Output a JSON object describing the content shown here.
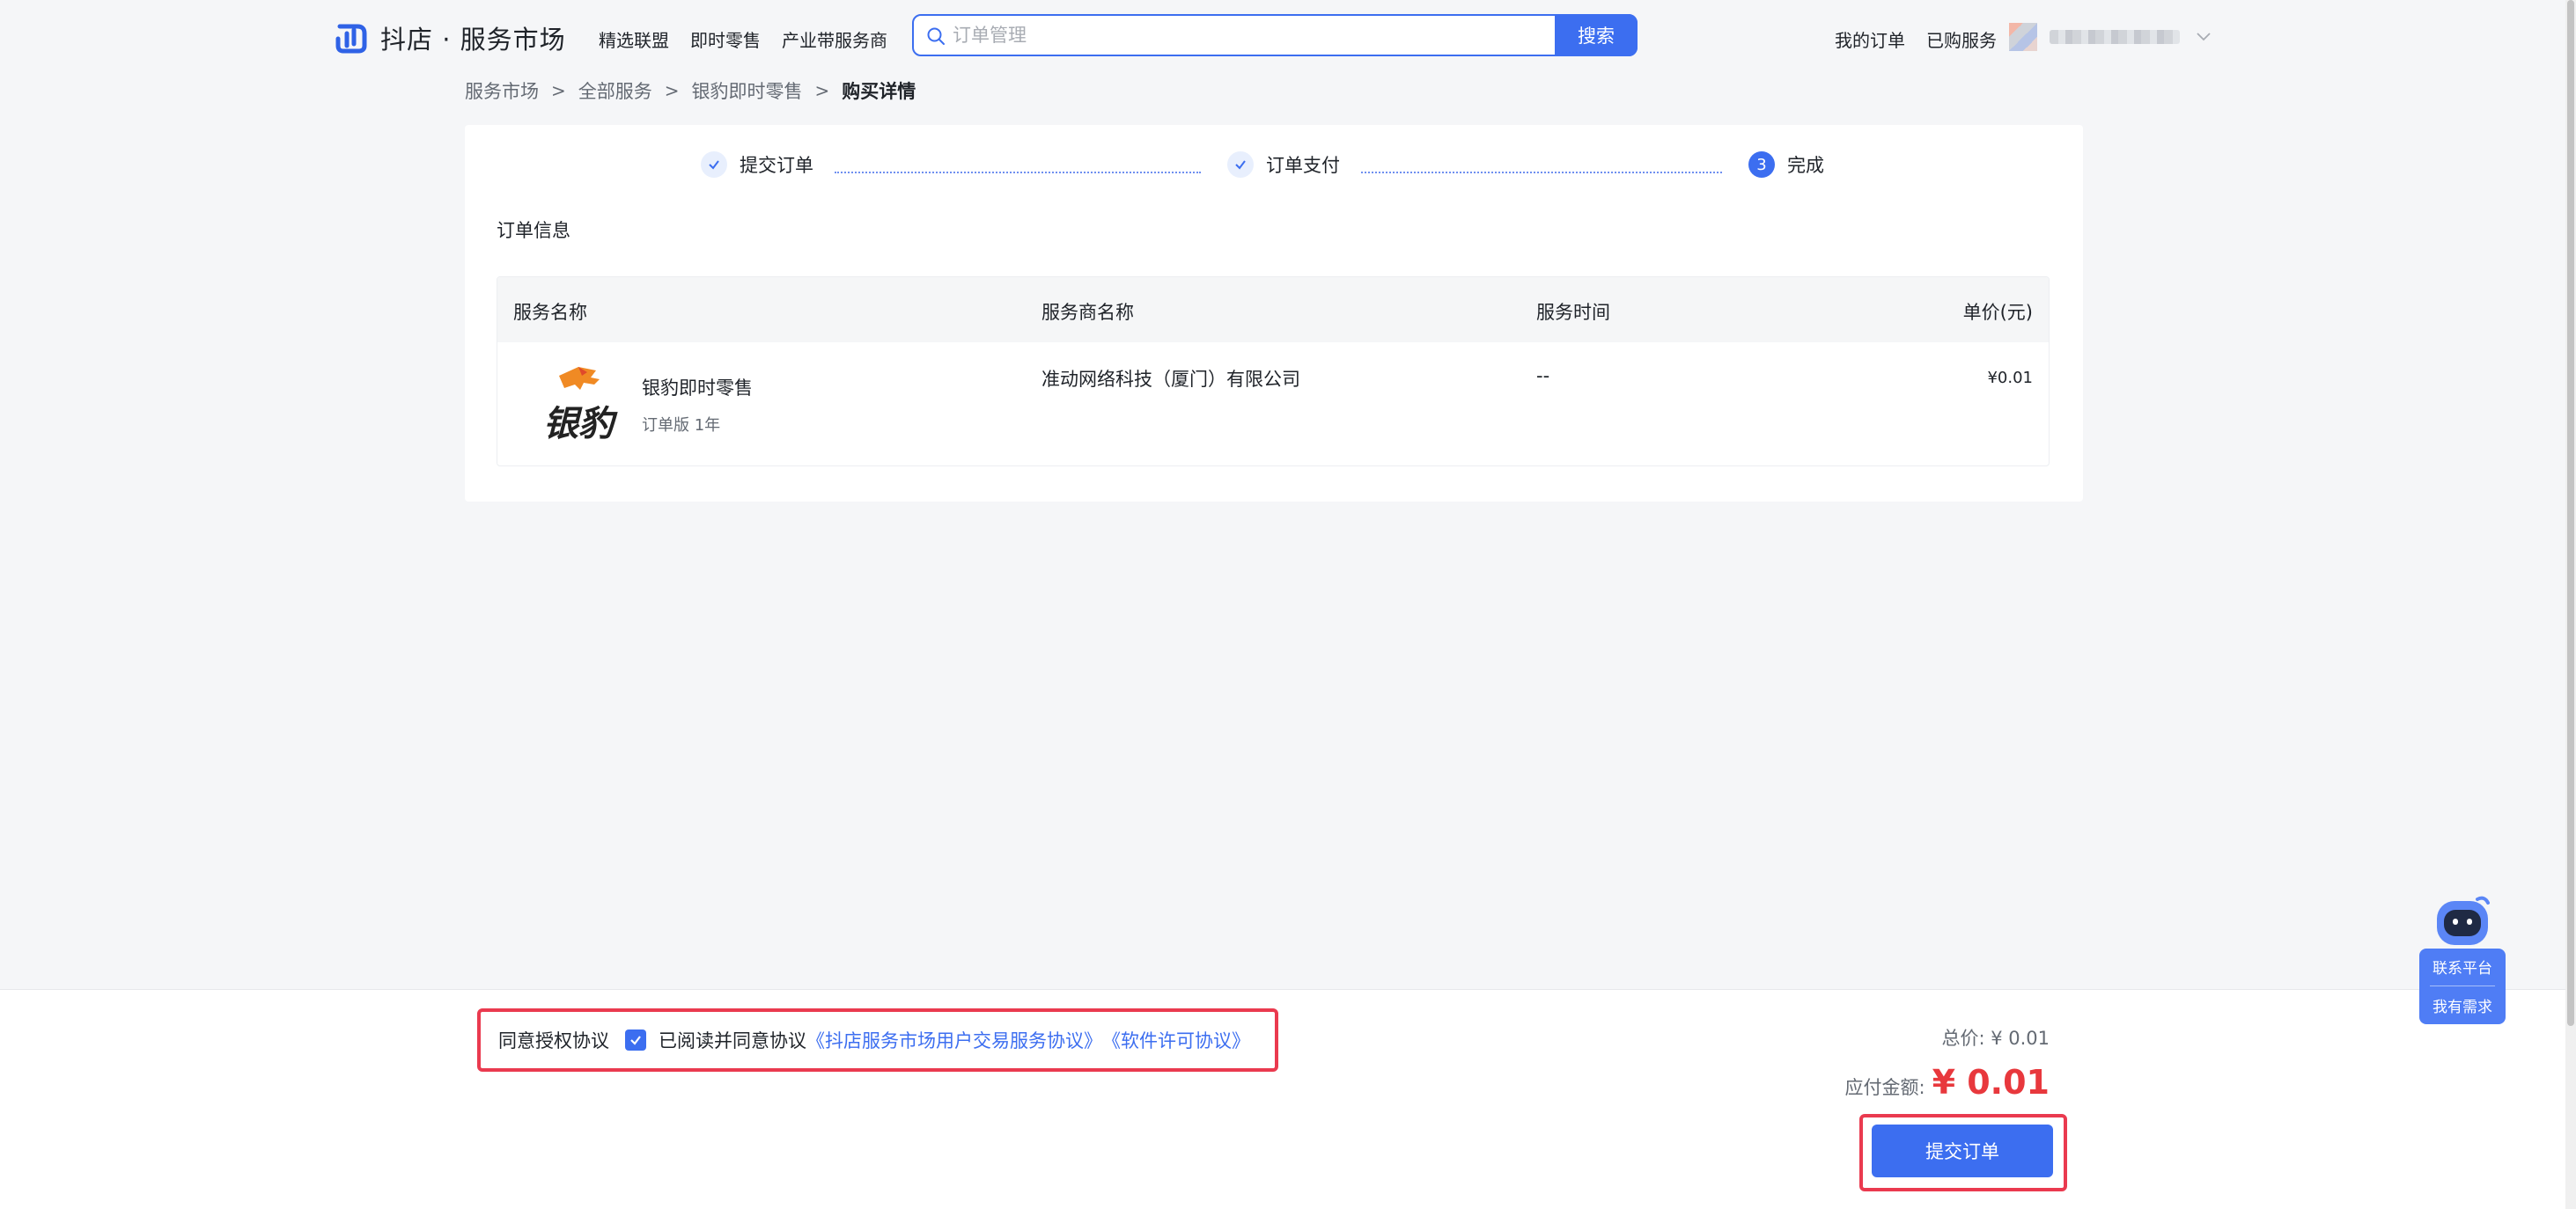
{
  "header": {
    "logo_text": "抖店 · 服务市场",
    "nav": [
      "精选联盟",
      "即时零售",
      "产业带服务商"
    ],
    "search": {
      "placeholder": "订单管理",
      "button_label": "搜索"
    },
    "right_links": [
      "我的订单",
      "已购服务"
    ]
  },
  "breadcrumb": {
    "items": [
      "服务市场",
      "全部服务",
      "银豹即时零售"
    ],
    "current": "购买详情",
    "separator": ">"
  },
  "steps": [
    {
      "label": "提交订单",
      "status": "done",
      "icon": "check-icon"
    },
    {
      "label": "订单支付",
      "status": "done",
      "icon": "check-icon"
    },
    {
      "label": "完成",
      "status": "current",
      "number": "3"
    }
  ],
  "order": {
    "section_title": "订单信息",
    "columns": [
      "服务名称",
      "服务商名称",
      "服务时间",
      "单价(元)"
    ],
    "rows": [
      {
        "service_name": "银豹即时零售",
        "edition": "订单版 1年",
        "logo_text": "银豹",
        "vendor": "准动网络科技（厦门）有限公司",
        "service_time": "--",
        "unit_price": "¥0.01"
      }
    ]
  },
  "footer": {
    "agreement_title": "同意授权协议",
    "agreement_text": "已阅读并同意协议",
    "agreement_links": [
      "《抖店服务市场用户交易服务协议》",
      "《软件许可协议》"
    ],
    "agreement_checked": true,
    "total_label": "总价: ¥ 0.01",
    "pay_label": "应付金额:",
    "pay_amount": "¥ 0.01",
    "submit_label": "提交订单"
  },
  "assistant": {
    "items": [
      "联系平台",
      "我有需求"
    ]
  },
  "colors": {
    "primary": "#3c6ef0",
    "price_red": "#e8383d",
    "highlight_border": "#ea3a4f",
    "page_bg": "#f5f6f8"
  }
}
